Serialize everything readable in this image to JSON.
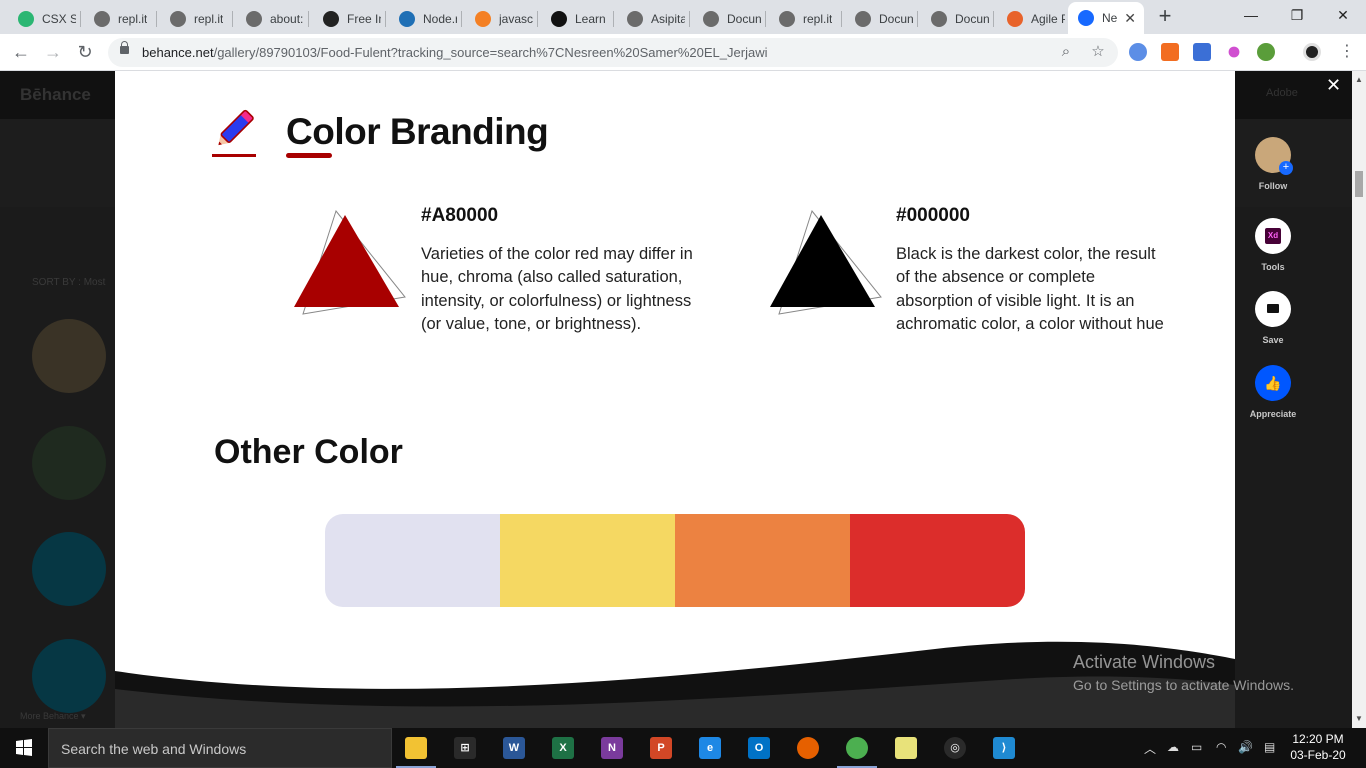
{
  "browser": {
    "tabs": [
      {
        "title": "CSX St",
        "icon": "csx-icon",
        "color": "#2bb673"
      },
      {
        "title": "repl.it",
        "icon": "replit-icon",
        "color": "#6b6b6b"
      },
      {
        "title": "repl.it",
        "icon": "replit-icon",
        "color": "#6b6b6b"
      },
      {
        "title": "about:",
        "icon": "globe-icon",
        "color": "#6b6b6b"
      },
      {
        "title": "Free In",
        "icon": "r-icon",
        "color": "#222"
      },
      {
        "title": "Node.r",
        "icon": "node-icon",
        "color": "#1f6fb5"
      },
      {
        "title": "javascr",
        "icon": "stackoverflow-icon",
        "color": "#f48024"
      },
      {
        "title": "Learn |",
        "icon": "learn-icon",
        "color": "#111"
      },
      {
        "title": "Asipita",
        "icon": "globe-icon",
        "color": "#6b6b6b"
      },
      {
        "title": "Docun",
        "icon": "globe-icon",
        "color": "#6b6b6b"
      },
      {
        "title": "repl.it",
        "icon": "replit-icon",
        "color": "#6b6b6b"
      },
      {
        "title": "Docun",
        "icon": "globe-icon",
        "color": "#6b6b6b"
      },
      {
        "title": "Docun",
        "icon": "globe-icon",
        "color": "#6b6b6b"
      },
      {
        "title": "Agile P",
        "icon": "agile-icon",
        "color": "#e8632b"
      },
      {
        "title": "Ne",
        "icon": "behance-icon",
        "color": "#1769ff",
        "active": true
      }
    ],
    "new_tab": "+",
    "window_controls": {
      "minimize": "—",
      "maximize": "❐",
      "close": "✕"
    },
    "url_domain": "behance.net",
    "url_path": "/gallery/89790103/Food-Fulent?tracking_source=search%7CNesreen%20Samer%20EL_Jerjawi"
  },
  "background": {
    "logo": "Bēhance",
    "sort_label": "SORT BY : Most",
    "footer": "More Behance ▾",
    "adobe": "Adobe"
  },
  "project": {
    "section_title": "Color Branding",
    "swatches": [
      {
        "hex": "#A80000",
        "color": "#a80000",
        "description": "Varieties of the color red may differ in hue, chroma (also called saturation, intensity, or colorfulness)  or lightness (or value, tone, or brightness)."
      },
      {
        "hex": "#000000",
        "color": "#000000",
        "description": "Black is the darkest color, the result of the absence or complete absorption of visible light. It is an achromatic color, a color without hue"
      }
    ],
    "other_title": "Other Color",
    "palette": [
      "#e1e1f0",
      "#f5d862",
      "#ec8241",
      "#dc2d2b"
    ]
  },
  "sidebar": {
    "close": "✕",
    "follow": "Follow",
    "tools": "Tools",
    "tools_badge": "Xd",
    "save": "Save",
    "appreciate": "Appreciate"
  },
  "watermark": {
    "line1": "Activate Windows",
    "line2": "Go to Settings to activate Windows."
  },
  "taskbar": {
    "search_placeholder": "Search the web and Windows",
    "apps": [
      {
        "name": "file-explorer",
        "color": "#f2c233",
        "glyph": ""
      },
      {
        "name": "store",
        "color": "#2a2a2a",
        "glyph": "⊞"
      },
      {
        "name": "word",
        "color": "#2b5797",
        "glyph": "W"
      },
      {
        "name": "excel",
        "color": "#1e7145",
        "glyph": "X"
      },
      {
        "name": "onenote",
        "color": "#7a3b9c",
        "glyph": "N"
      },
      {
        "name": "powerpoint",
        "color": "#d24726",
        "glyph": "P"
      },
      {
        "name": "edge",
        "color": "#1e88e5",
        "glyph": "e"
      },
      {
        "name": "outlook",
        "color": "#0072c6",
        "glyph": "O"
      },
      {
        "name": "firefox",
        "color": "#e66000",
        "glyph": ""
      },
      {
        "name": "chrome",
        "color": "#4caf50",
        "glyph": "",
        "active": true
      },
      {
        "name": "sticky-notes",
        "color": "#e8e27a",
        "glyph": ""
      },
      {
        "name": "groove-music",
        "color": "#2a2a2a",
        "glyph": "◎"
      },
      {
        "name": "vscode",
        "color": "#1f8ad2",
        "glyph": "⟩"
      }
    ],
    "time": "12:20 PM",
    "date": "03-Feb-20"
  }
}
